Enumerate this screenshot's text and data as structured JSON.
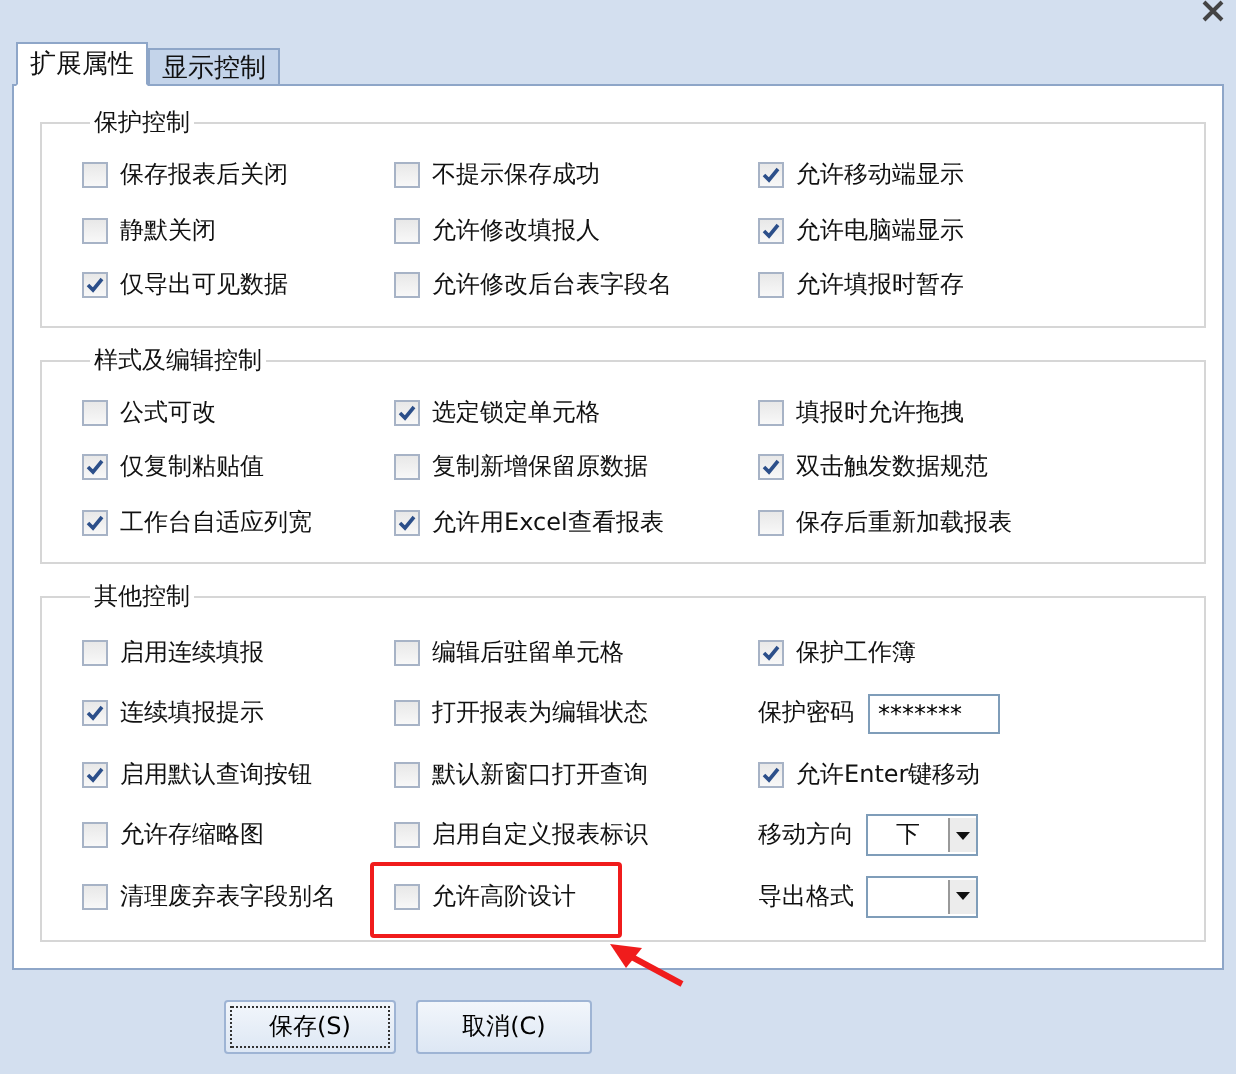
{
  "tabs": [
    {
      "label": "扩展属性",
      "selected": true
    },
    {
      "label": "显示控制",
      "selected": false
    }
  ],
  "groups": [
    {
      "title": "保护控制",
      "items": [
        {
          "kind": "checkbox",
          "label": "保存报表后关闭",
          "checked": false
        },
        {
          "kind": "checkbox",
          "label": "不提示保存成功",
          "checked": false
        },
        {
          "kind": "checkbox",
          "label": "允许移动端显示",
          "checked": true
        },
        {
          "kind": "checkbox",
          "label": "静默关闭",
          "checked": false
        },
        {
          "kind": "checkbox",
          "label": "允许修改填报人",
          "checked": false
        },
        {
          "kind": "checkbox",
          "label": "允许电脑端显示",
          "checked": true
        },
        {
          "kind": "checkbox",
          "label": "仅导出可见数据",
          "checked": true
        },
        {
          "kind": "checkbox",
          "label": "允许修改后台表字段名",
          "checked": false
        },
        {
          "kind": "checkbox",
          "label": "允许填报时暂存",
          "checked": false
        }
      ]
    },
    {
      "title": "样式及编辑控制",
      "items": [
        {
          "kind": "checkbox",
          "label": "公式可改",
          "checked": false
        },
        {
          "kind": "checkbox",
          "label": "选定锁定单元格",
          "checked": true
        },
        {
          "kind": "checkbox",
          "label": "填报时允许拖拽",
          "checked": false
        },
        {
          "kind": "checkbox",
          "label": "仅复制粘贴值",
          "checked": true
        },
        {
          "kind": "checkbox",
          "label": "复制新增保留原数据",
          "checked": false
        },
        {
          "kind": "checkbox",
          "label": "双击触发数据规范",
          "checked": true
        },
        {
          "kind": "checkbox",
          "label": "工作台自适应列宽",
          "checked": true
        },
        {
          "kind": "checkbox",
          "label": "允许用Excel查看报表",
          "checked": true
        },
        {
          "kind": "checkbox",
          "label": "保存后重新加载报表",
          "checked": false
        }
      ]
    },
    {
      "title": "其他控制",
      "items": [
        {
          "kind": "checkbox",
          "label": "启用连续填报",
          "checked": false
        },
        {
          "kind": "checkbox",
          "label": "编辑后驻留单元格",
          "checked": false
        },
        {
          "kind": "checkbox",
          "label": "保护工作簿",
          "checked": true
        },
        {
          "kind": "checkbox",
          "label": "连续填报提示",
          "checked": true
        },
        {
          "kind": "checkbox",
          "label": "打开报表为编辑状态",
          "checked": false
        },
        {
          "kind": "password",
          "label": "保护密码",
          "value": "*******"
        },
        {
          "kind": "checkbox",
          "label": "启用默认查询按钮",
          "checked": true
        },
        {
          "kind": "checkbox",
          "label": "默认新窗口打开查询",
          "checked": false
        },
        {
          "kind": "checkbox",
          "label": "允许Enter键移动",
          "checked": true
        },
        {
          "kind": "checkbox",
          "label": "允许存缩略图",
          "checked": false
        },
        {
          "kind": "checkbox",
          "label": "启用自定义报表标识",
          "checked": false
        },
        {
          "kind": "select",
          "label": "移动方向",
          "value": "下"
        },
        {
          "kind": "checkbox",
          "label": "清理废弃表字段别名",
          "checked": false
        },
        {
          "kind": "checkbox",
          "label": "允许高阶设计",
          "checked": false,
          "highlighted": true
        },
        {
          "kind": "select",
          "label": "导出格式"
        }
      ]
    }
  ],
  "buttons": [
    {
      "label": "保存(S)",
      "focused": true
    },
    {
      "label": "取消(C)",
      "focused": false
    }
  ]
}
